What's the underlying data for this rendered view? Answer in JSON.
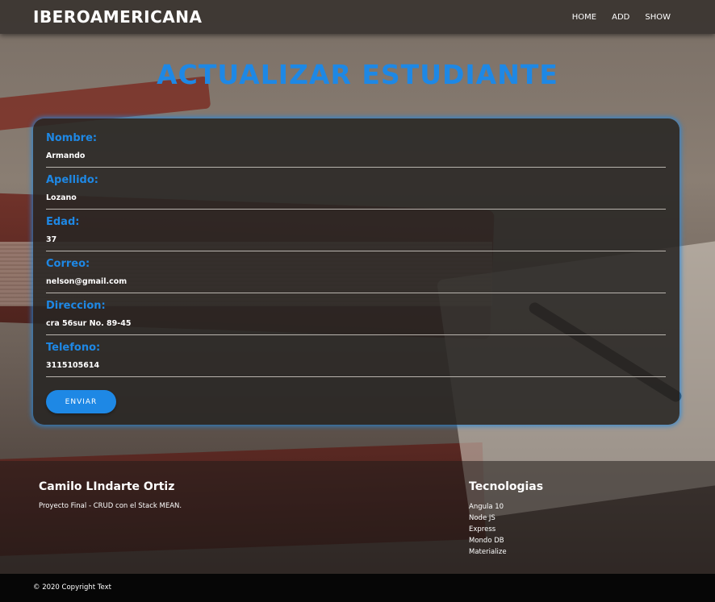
{
  "navbar": {
    "brand": "IBEROAMERICANA",
    "links": [
      "HOME",
      "ADD",
      "SHOW"
    ]
  },
  "page_title": "ACTUALIZAR ESTUDIANTE",
  "form": {
    "fields": [
      {
        "label": "Nombre:",
        "value": "Armando"
      },
      {
        "label": "Apellido:",
        "value": "Lozano"
      },
      {
        "label": "Edad:",
        "value": "37"
      },
      {
        "label": "Correo:",
        "value": "nelson@gmail.com"
      },
      {
        "label": "Direccion:",
        "value": "cra 56sur No. 89-45"
      },
      {
        "label": "Telefono:",
        "value": "3115105614"
      }
    ],
    "submit_label": "ENVIAR"
  },
  "footer": {
    "author": "Camilo LIndarte Ortiz",
    "description": "Proyecto Final - CRUD con el Stack MEAN.",
    "tech_title": "Tecnologias",
    "tech_items": [
      "Angula 10",
      "Node JS",
      "Express",
      "Mondo DB",
      "Materialize"
    ],
    "copyright": "© 2020 Copyright Text"
  },
  "colors": {
    "accent": "#1e88e5",
    "navbar": "#322d2a",
    "copyright_bar": "#060606"
  }
}
